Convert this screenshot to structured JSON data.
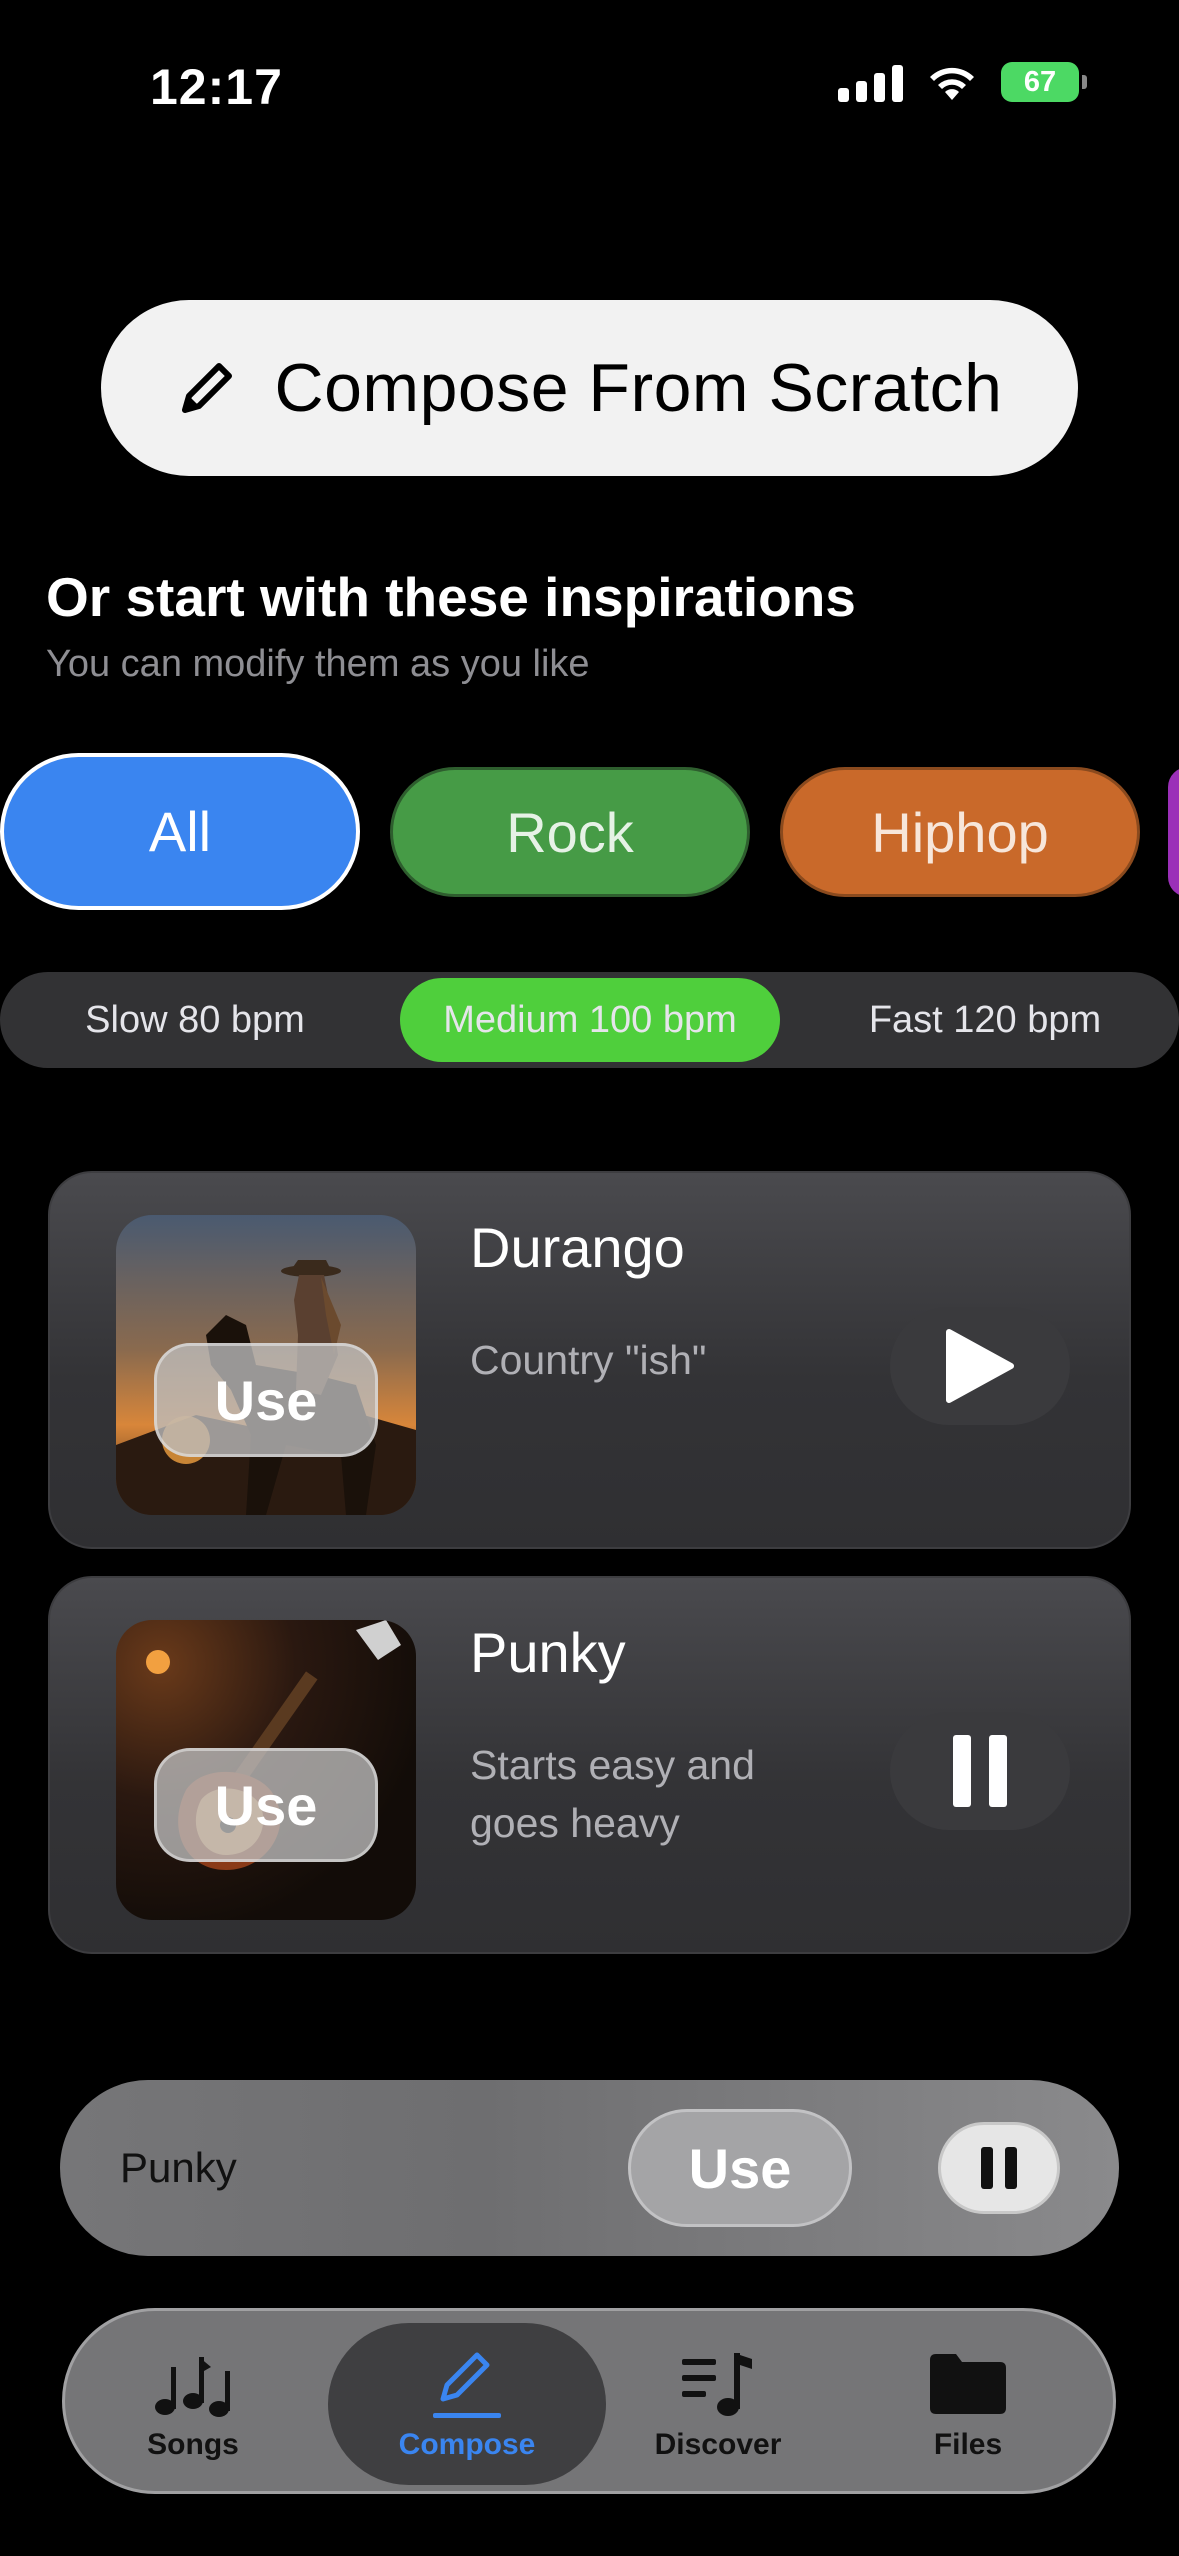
{
  "status": {
    "time": "12:17",
    "battery": "67"
  },
  "compose": {
    "label": "Compose From Scratch"
  },
  "inspirations": {
    "title": "Or start with these inspirations",
    "subtitle": "You can modify them as you like"
  },
  "genres": [
    "All",
    "Rock",
    "Hiphop"
  ],
  "tempo": {
    "slow": "Slow 80 bpm",
    "medium": "Medium 100 bpm",
    "fast": "Fast 120 bpm",
    "selected": "medium"
  },
  "cards": [
    {
      "name": "Durango",
      "description": "Country \"ish\"",
      "use_label": "Use",
      "state": "play"
    },
    {
      "name": "Punky",
      "description": "Starts easy and goes heavy",
      "use_label": "Use",
      "state": "pause"
    }
  ],
  "player": {
    "title": "Punky",
    "use_label": "Use"
  },
  "tabs": {
    "songs": "Songs",
    "compose": "Compose",
    "discover": "Discover",
    "files": "Files",
    "active": "compose"
  },
  "colors": {
    "accent": "#3a85f0",
    "rock": "#469b46",
    "hiphop": "#c9692a",
    "tempo_selected": "#4fcf3c"
  }
}
